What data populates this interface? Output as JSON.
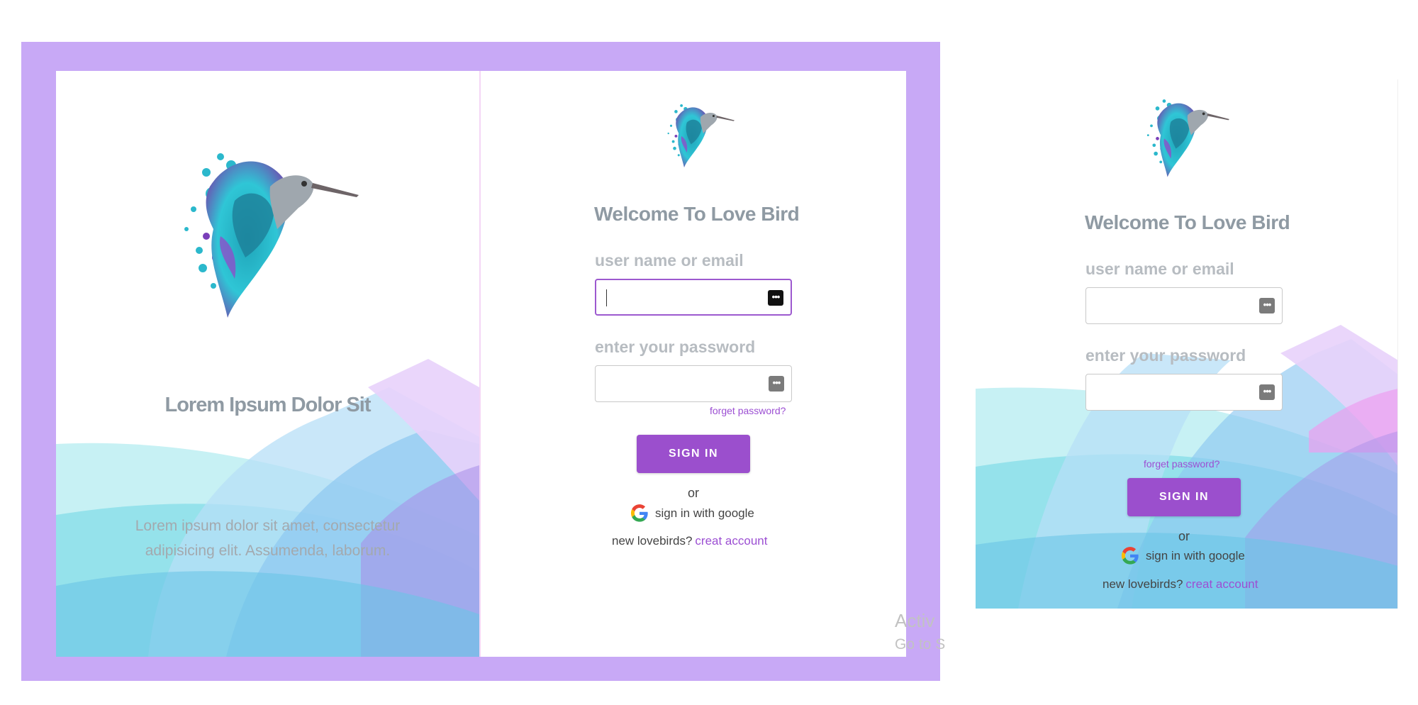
{
  "hero": {
    "title": "Lorem Ipsum Dolor Sit",
    "text_line1": "Lorem ipsum dolor sit amet, consectetur",
    "text_line2": "adipisicing elit. Assumenda, laborum."
  },
  "login": {
    "welcome": "Welcome To Love Bird",
    "username_label": "user name or email",
    "username_value": "",
    "password_label": "enter your password",
    "password_value": "",
    "forgot_label": "forget password?",
    "signin_label": "SIGN IN",
    "or_label": "or",
    "google_label": "sign in with google",
    "new_prefix": "new lovebirds?",
    "create_link": "creat account",
    "password_manager_icon": "ellipsis-key-icon"
  },
  "watermark": {
    "line1": "Activ",
    "line2": "Go to S"
  },
  "colors": {
    "frame": "#c8a9f6",
    "accent": "#9b4fcd",
    "link": "#9c4fd3",
    "heading": "#8f9aa3"
  }
}
